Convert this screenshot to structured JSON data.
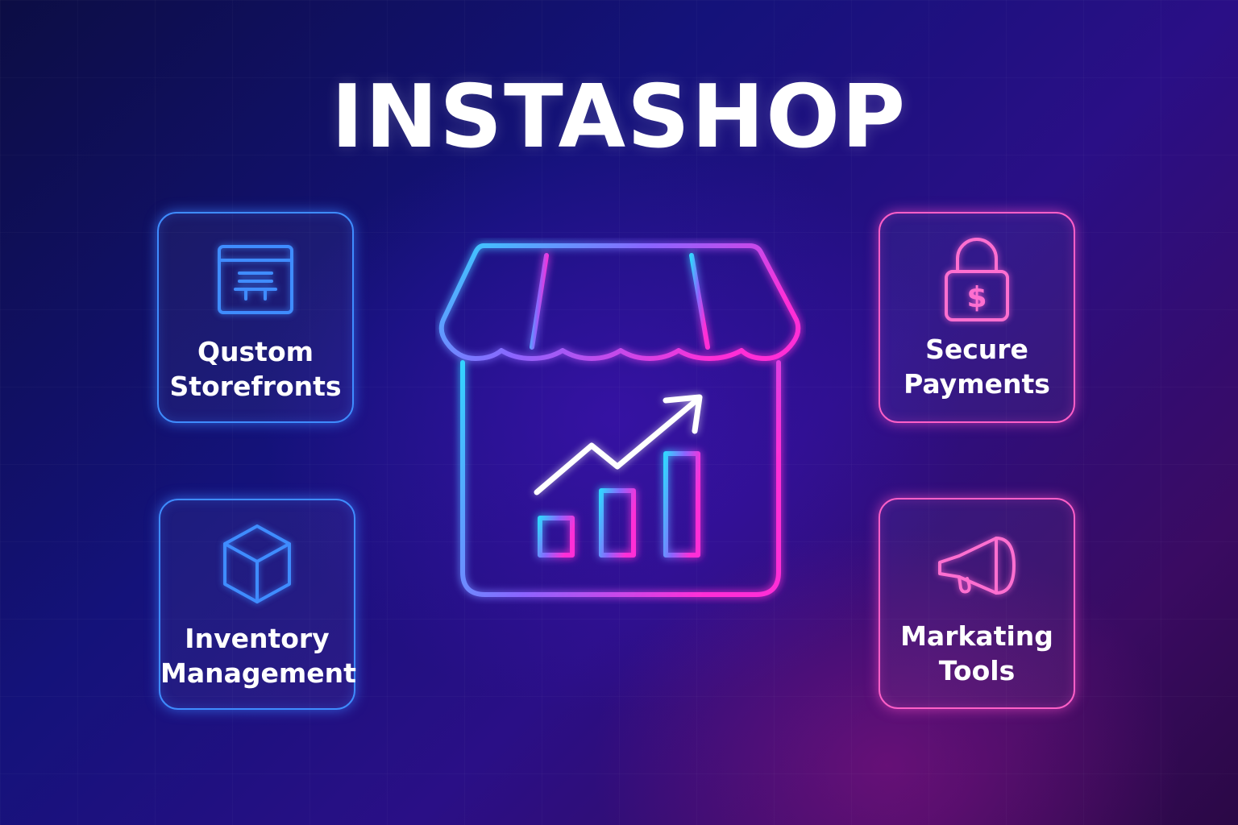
{
  "title": "INSTASHOP",
  "colors": {
    "accent_blue": "#3f8cff",
    "accent_cyan": "#33d4ff",
    "accent_pink": "#ff3fd2",
    "text": "#ffffff"
  },
  "features": {
    "storefronts": {
      "line1": "Qustom",
      "line2": "Storefronts",
      "icon": "storefront-window-icon"
    },
    "inventory": {
      "line1": "Inventory",
      "line2": "Management",
      "icon": "box-icon"
    },
    "payments": {
      "line1": "Secure",
      "line2": "Payments",
      "icon": "padlock-dollar-icon"
    },
    "marketing": {
      "line1": "Markating",
      "line2": "Tools",
      "icon": "megaphone-icon"
    }
  },
  "center": {
    "icon": "shop-growth-chart-icon"
  }
}
